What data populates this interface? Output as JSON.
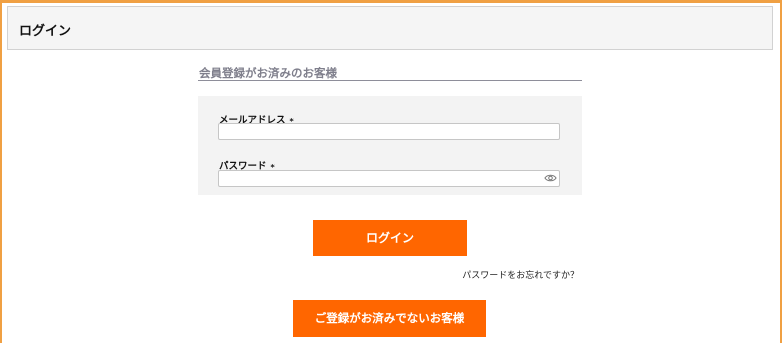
{
  "header": {
    "title": "ログイン"
  },
  "section": {
    "heading": "会員登録がお済みのお客様"
  },
  "form": {
    "email": {
      "label": "メールアドレス",
      "required_mark": "*",
      "value": "",
      "placeholder": ""
    },
    "password": {
      "label": "パスワード",
      "required_mark": "*",
      "value": "",
      "placeholder": "",
      "toggle_icon": "eye-icon"
    }
  },
  "actions": {
    "login_label": "ログイン",
    "forgot_password": "パスワードをお忘れですか？",
    "register_label": "ご登録がお済みでないお客様"
  },
  "colors": {
    "accent": "#ff6600",
    "frame_border": "#f0a043",
    "header_bg": "#f5f5f5",
    "panel_bg": "#f3f3f3",
    "heading_text": "#7f7f8c"
  }
}
